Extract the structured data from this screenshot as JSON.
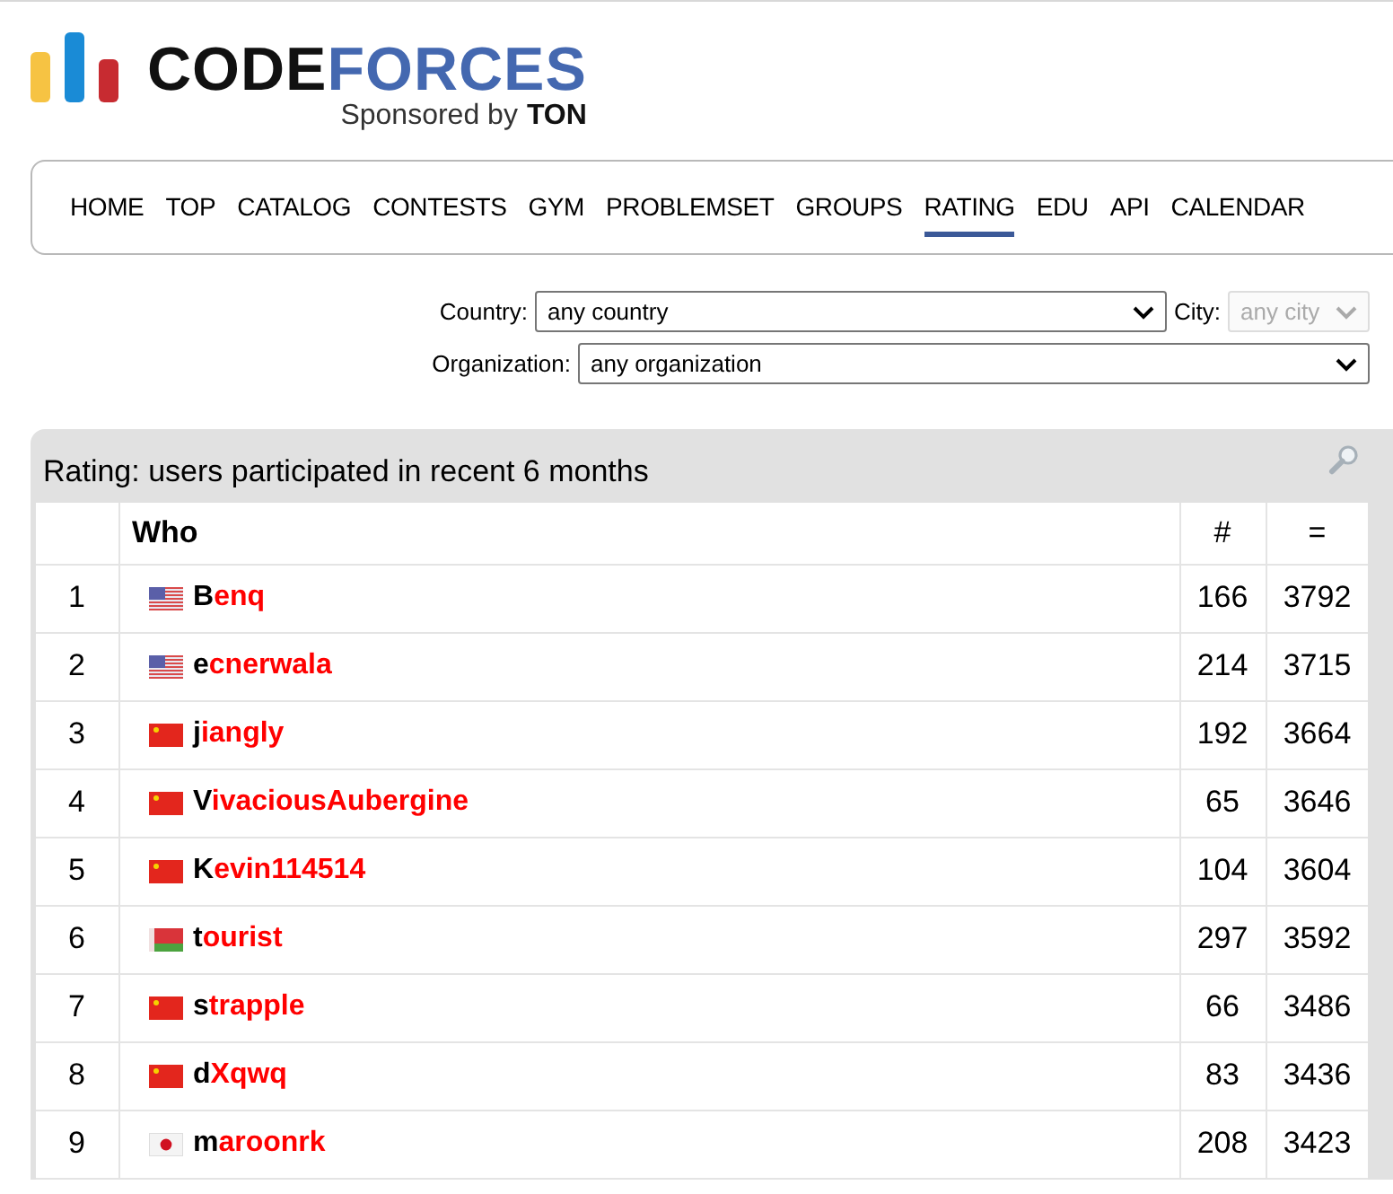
{
  "logo": {
    "word_dark": "CODE",
    "word_blue": "FORCES",
    "sponsor": "Sponsored by",
    "sponsor_bold": "TON"
  },
  "nav": [
    {
      "label": "HOME",
      "selected": false
    },
    {
      "label": "TOP",
      "selected": false
    },
    {
      "label": "CATALOG",
      "selected": false
    },
    {
      "label": "CONTESTS",
      "selected": false
    },
    {
      "label": "GYM",
      "selected": false
    },
    {
      "label": "PROBLEMSET",
      "selected": false
    },
    {
      "label": "GROUPS",
      "selected": false
    },
    {
      "label": "RATING",
      "selected": true
    },
    {
      "label": "EDU",
      "selected": false
    },
    {
      "label": "API",
      "selected": false
    },
    {
      "label": "CALENDAR",
      "selected": false
    }
  ],
  "filters": {
    "country_label": "Country:",
    "country": "any country",
    "city_label": "City:",
    "city": "any city",
    "city_disabled": true,
    "organization_label": "Organization:",
    "organization": "any organization"
  },
  "panel": {
    "title": "Rating: users participated in recent 6 months"
  },
  "table": {
    "columns": [
      "Who",
      "#",
      "="
    ],
    "rows": [
      {
        "rank": "1",
        "flag": {
          "kind": "us"
        },
        "handle": "Benq",
        "count": "166",
        "rating": "3792"
      },
      {
        "rank": "2",
        "flag": {
          "kind": "us"
        },
        "handle": "ecnerwala",
        "count": "214",
        "rating": "3715"
      },
      {
        "rank": "3",
        "flag": {
          "kind": "cn"
        },
        "handle": "jiangly",
        "count": "192",
        "rating": "3664"
      },
      {
        "rank": "4",
        "flag": {
          "kind": "cn"
        },
        "handle": "VivaciousAubergine",
        "count": "65",
        "rating": "3646"
      },
      {
        "rank": "5",
        "flag": {
          "kind": "cn"
        },
        "handle": "Kevin114514",
        "count": "104",
        "rating": "3604"
      },
      {
        "rank": "6",
        "flag": {
          "kind": "by"
        },
        "handle": "tourist",
        "count": "297",
        "rating": "3592"
      },
      {
        "rank": "7",
        "flag": {
          "kind": "cn"
        },
        "handle": "strapple",
        "count": "66",
        "rating": "3486"
      },
      {
        "rank": "8",
        "flag": {
          "kind": "cn"
        },
        "handle": "dXqwq",
        "count": "83",
        "rating": "3436"
      },
      {
        "rank": "9",
        "flag": {
          "kind": "jp"
        },
        "handle": "maroonrk",
        "count": "208",
        "rating": "3423"
      }
    ]
  }
}
